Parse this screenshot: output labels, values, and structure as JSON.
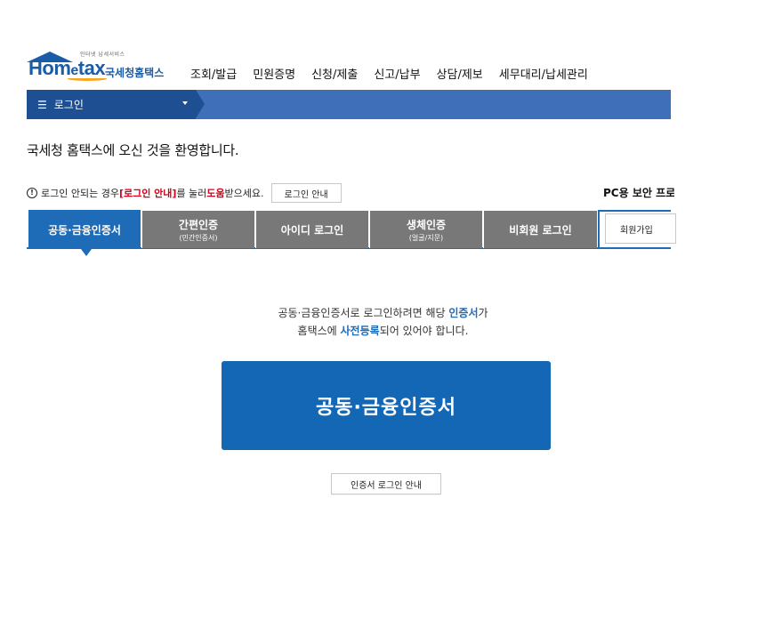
{
  "header": {
    "logo_small_text": "인터넷 납세서비스",
    "logo_home": "Hom",
    "logo_e": "e",
    "logo_tax": "tax",
    "logo_korean": "국세청홈택스",
    "nav": [
      {
        "label": "조회/발급"
      },
      {
        "label": "민원증명"
      },
      {
        "label": "신청/제출"
      },
      {
        "label": "신고/납부"
      },
      {
        "label": "상담/제보"
      },
      {
        "label": "세무대리/납세관리"
      }
    ]
  },
  "topbar": {
    "menu_label": "로그인",
    "menu_icon": "hamburger-icon"
  },
  "welcome": "국세청 홈택스에 오신 것을 환영합니다.",
  "notice": {
    "icon": "!",
    "text_before": "로그인 안되는 경우 ",
    "red1": "[로그인 안내]",
    "text_mid": "를 눌러 ",
    "red2": "도움",
    "text_after": "받으세요.",
    "button_label": "로그인 안내"
  },
  "pc_security": "PC용 보안 프로그램",
  "tabs": [
    {
      "main": "공동·금융인증서",
      "sub": ""
    },
    {
      "main": "간편인증",
      "sub": "(민간인증서)"
    },
    {
      "main": "아이디 로그인",
      "sub": ""
    },
    {
      "main": "생체인증",
      "sub": "(얼굴/지문)"
    },
    {
      "main": "비회원 로그인",
      "sub": ""
    }
  ],
  "signup_label": "회원가입",
  "description": {
    "line1_before": "공동·금융인증서로 로그인하려면 해당 ",
    "line1_blue": "인증서",
    "line1_after": "가",
    "line2_before": "홈택스에 ",
    "line2_blue": "사전등록",
    "line2_after": "되어 있어야 합니다."
  },
  "main_button_label": "공동·금융인증서",
  "guide_button_label": "인증서 로그인 안내",
  "colors": {
    "primary": "#1467b5",
    "topbar": "#3e6fb8",
    "topbar_dark": "#1e4f92",
    "tab_inactive": "#787878",
    "notice_red": "#d0021b",
    "logo_orange": "#f5a623"
  }
}
